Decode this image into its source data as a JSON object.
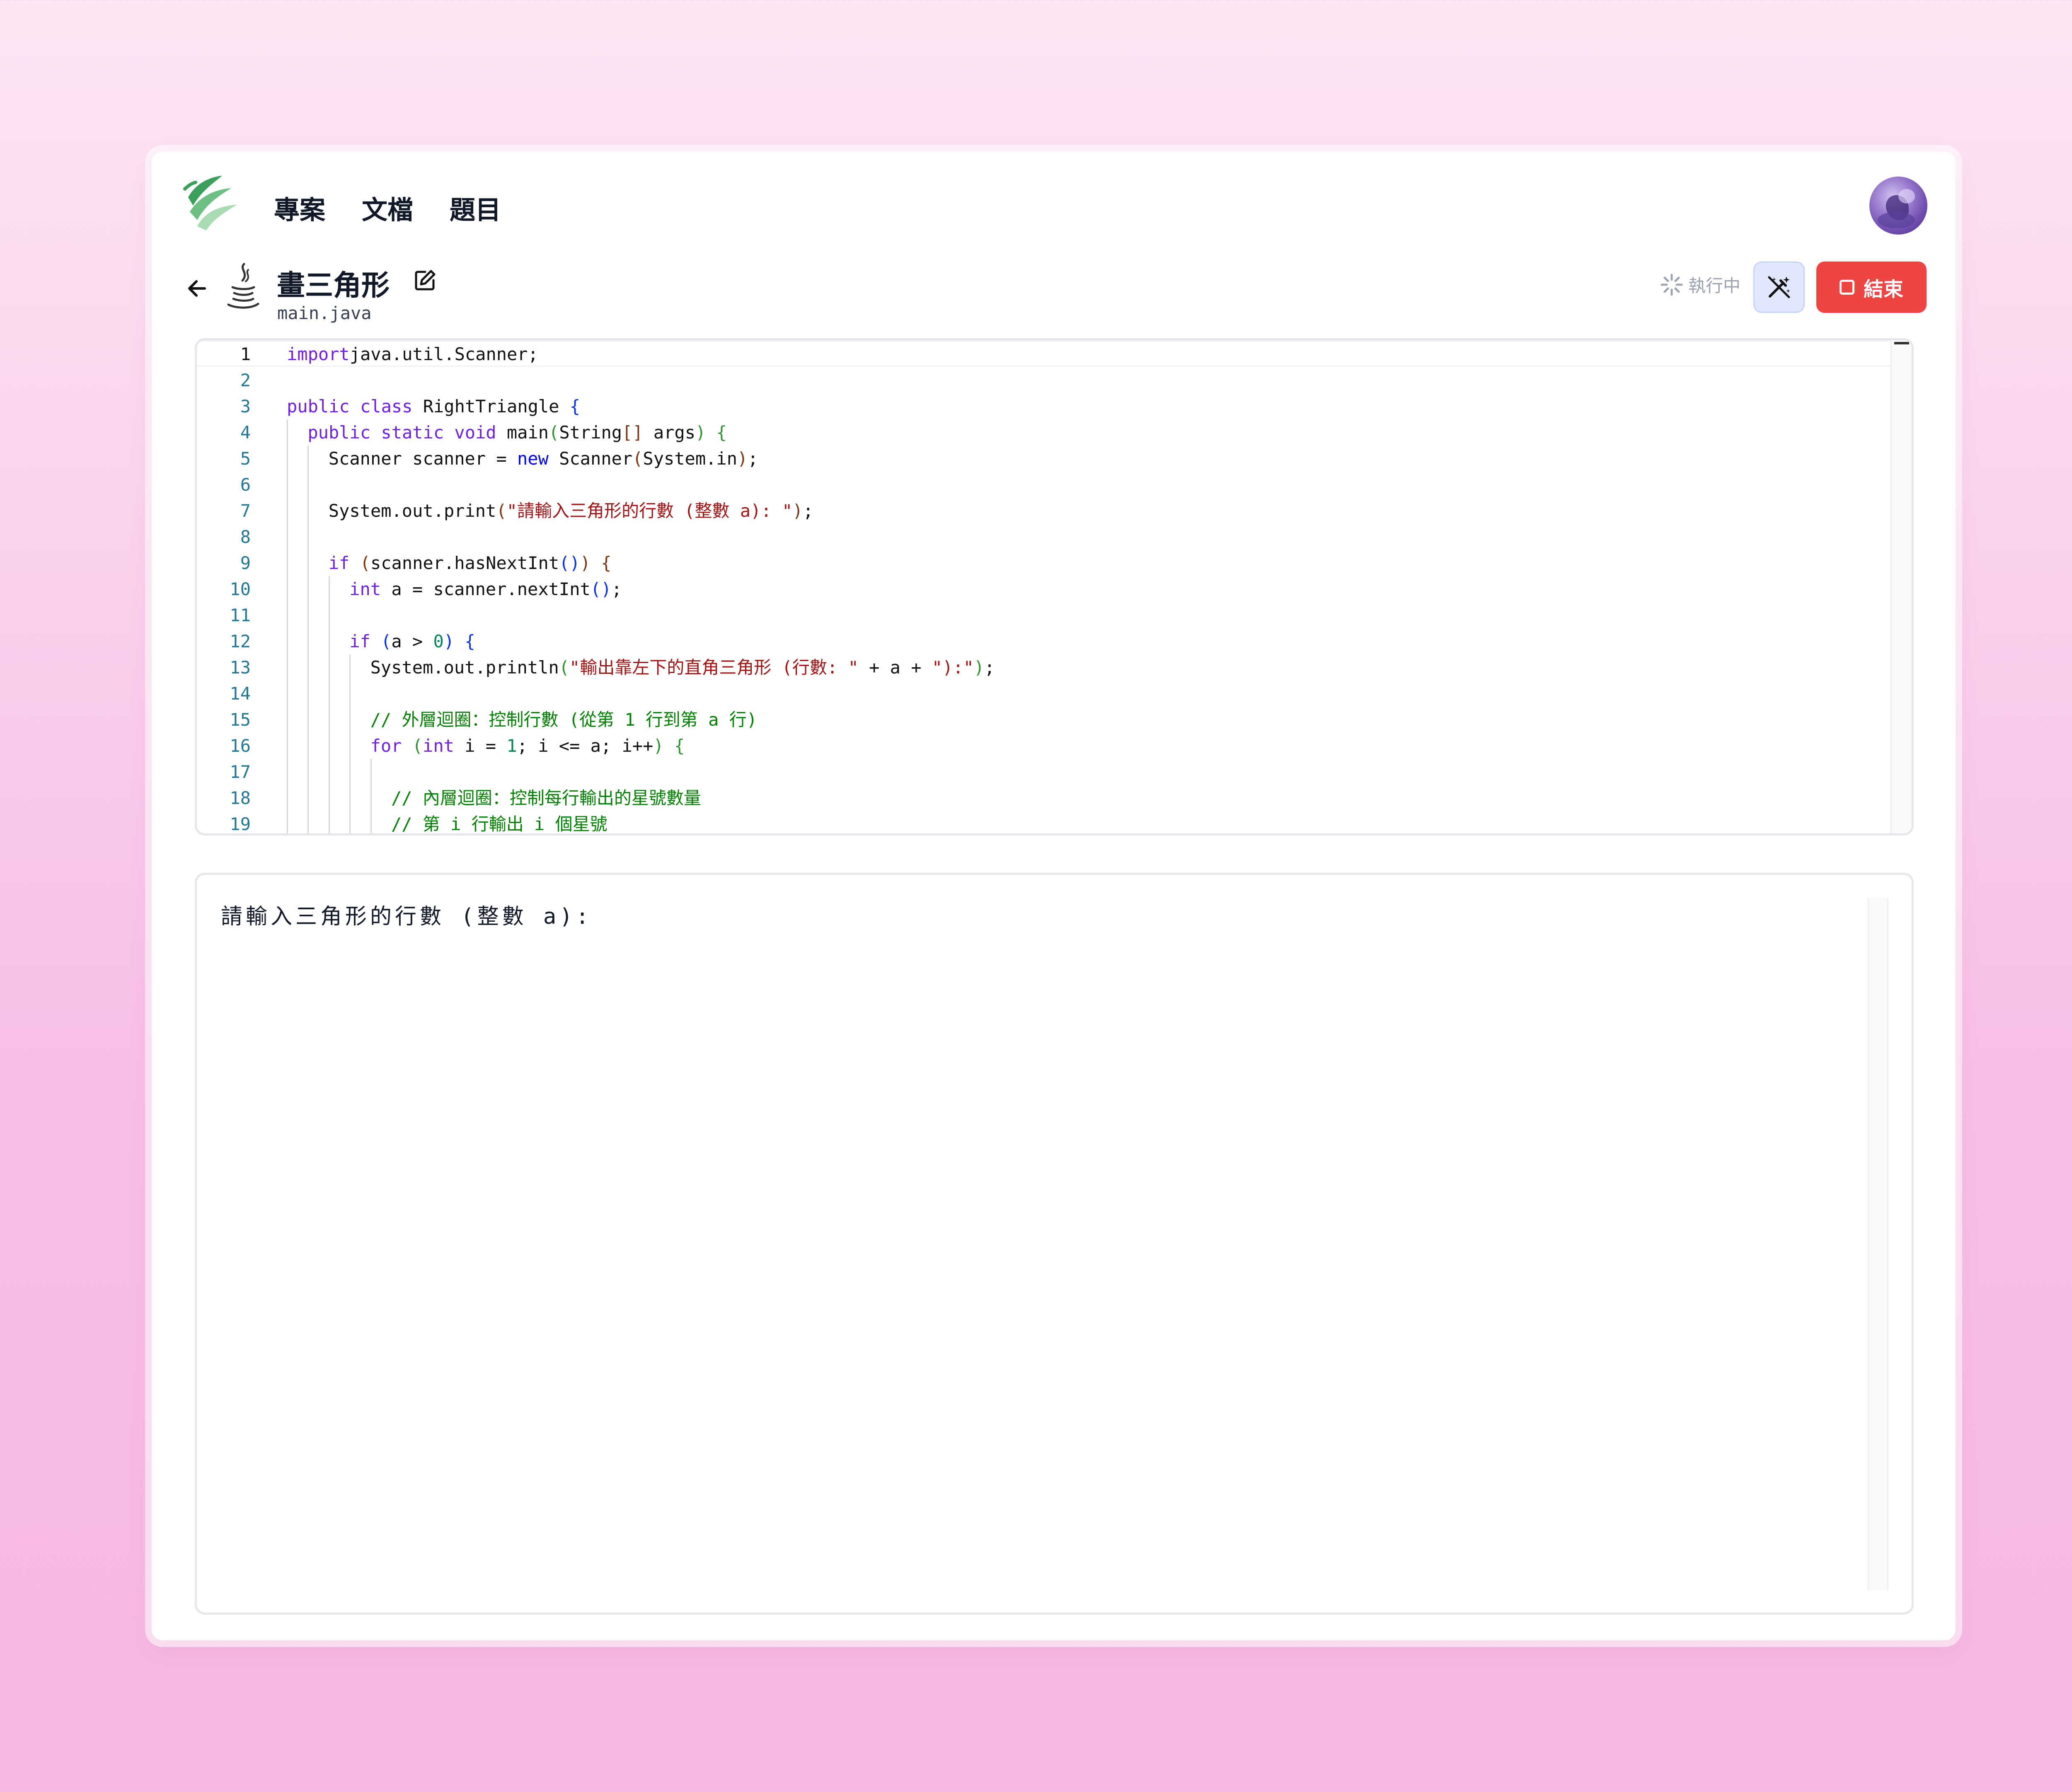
{
  "nav": {
    "items": [
      "專案",
      "文檔",
      "題目"
    ]
  },
  "project": {
    "title": "畫三角形",
    "filename": "main.java"
  },
  "status": {
    "text": "執行中"
  },
  "actions": {
    "stop_label": "結束"
  },
  "editor": {
    "active_line": 1,
    "lines": [
      {
        "n": "1",
        "indent": 0,
        "tokens": [
          [
            "kw2",
            "import"
          ],
          [
            "",
            "java.util.Scanner;"
          ]
        ]
      },
      {
        "n": "2",
        "indent": 0,
        "tokens": []
      },
      {
        "n": "3",
        "indent": 0,
        "tokens": [
          [
            "kw2",
            "public"
          ],
          [
            "",
            ""
          ],
          [
            "kw2",
            "class"
          ],
          [
            "",
            " RightTriangle "
          ],
          [
            "b1",
            "{"
          ]
        ]
      },
      {
        "n": "4",
        "indent": 1,
        "tokens": [
          [
            "kw2",
            "public"
          ],
          [
            "",
            " "
          ],
          [
            "kw2",
            "static"
          ],
          [
            "",
            " "
          ],
          [
            "kw2",
            "void"
          ],
          [
            "",
            " main"
          ],
          [
            "b2",
            "("
          ],
          [
            "",
            "String"
          ],
          [
            "b3",
            "[]"
          ],
          [
            "",
            " args"
          ],
          [
            "b2",
            ")"
          ],
          [
            "",
            " "
          ],
          [
            "b2",
            "{"
          ]
        ]
      },
      {
        "n": "5",
        "indent": 2,
        "tokens": [
          [
            "",
            "Scanner scanner = "
          ],
          [
            "kw",
            "new"
          ],
          [
            "",
            " Scanner"
          ],
          [
            "b3",
            "("
          ],
          [
            "",
            "System.in"
          ],
          [
            "b3",
            ")"
          ],
          [
            "",
            ";"
          ]
        ]
      },
      {
        "n": "6",
        "indent": 2,
        "tokens": []
      },
      {
        "n": "7",
        "indent": 2,
        "tokens": [
          [
            "",
            "System.out.print"
          ],
          [
            "b3",
            "("
          ],
          [
            "str",
            "\"請輸入三角形的行數 (整數 a): \""
          ],
          [
            "b3",
            ")"
          ],
          [
            "",
            ";"
          ]
        ]
      },
      {
        "n": "8",
        "indent": 2,
        "tokens": []
      },
      {
        "n": "9",
        "indent": 2,
        "tokens": [
          [
            "kw2",
            "if"
          ],
          [
            "",
            " "
          ],
          [
            "b3",
            "("
          ],
          [
            "",
            "scanner.hasNextInt"
          ],
          [
            "b1",
            "()"
          ],
          [
            "b3",
            ")"
          ],
          [
            "",
            " "
          ],
          [
            "b3",
            "{"
          ]
        ]
      },
      {
        "n": "10",
        "indent": 3,
        "tokens": [
          [
            "kw2",
            "int"
          ],
          [
            "",
            " a = scanner.nextInt"
          ],
          [
            "b1",
            "()"
          ],
          [
            "",
            ";"
          ]
        ]
      },
      {
        "n": "11",
        "indent": 3,
        "tokens": []
      },
      {
        "n": "12",
        "indent": 3,
        "tokens": [
          [
            "kw2",
            "if"
          ],
          [
            "",
            " "
          ],
          [
            "b1",
            "("
          ],
          [
            "",
            "a > "
          ],
          [
            "num",
            "0"
          ],
          [
            "b1",
            ")"
          ],
          [
            "",
            " "
          ],
          [
            "b1",
            "{"
          ]
        ]
      },
      {
        "n": "13",
        "indent": 4,
        "tokens": [
          [
            "",
            "System.out.println"
          ],
          [
            "b2",
            "("
          ],
          [
            "str",
            "\"輸出靠左下的直角三角形 (行數: \""
          ],
          [
            "",
            " + a + "
          ],
          [
            "str",
            "\"):\""
          ],
          [
            "b2",
            ")"
          ],
          [
            "",
            ";"
          ]
        ]
      },
      {
        "n": "14",
        "indent": 4,
        "tokens": []
      },
      {
        "n": "15",
        "indent": 4,
        "tokens": [
          [
            "cm",
            "// 外層迴圈：控制行數 (從第 1 行到第 a 行)"
          ]
        ]
      },
      {
        "n": "16",
        "indent": 4,
        "tokens": [
          [
            "kw2",
            "for"
          ],
          [
            "",
            " "
          ],
          [
            "b2",
            "("
          ],
          [
            "kw2",
            "int"
          ],
          [
            "",
            " i = "
          ],
          [
            "num",
            "1"
          ],
          [
            "",
            "; i <= a; i++"
          ],
          [
            "b2",
            ")"
          ],
          [
            "",
            " "
          ],
          [
            "b2",
            "{"
          ]
        ]
      },
      {
        "n": "17",
        "indent": 5,
        "tokens": []
      },
      {
        "n": "18",
        "indent": 5,
        "tokens": [
          [
            "cm",
            "// 內層迴圈：控制每行輸出的星號數量"
          ]
        ]
      },
      {
        "n": "19",
        "indent": 5,
        "tokens": [
          [
            "cm",
            "// 第 i 行輸出 i 個星號"
          ]
        ]
      }
    ]
  },
  "console": {
    "output": "請輸入三角形的行數 (整數 a):"
  },
  "colors": {
    "accent": "#ef4444",
    "brand": "#3aa05a",
    "magic_bg": "#e0e7ff"
  }
}
